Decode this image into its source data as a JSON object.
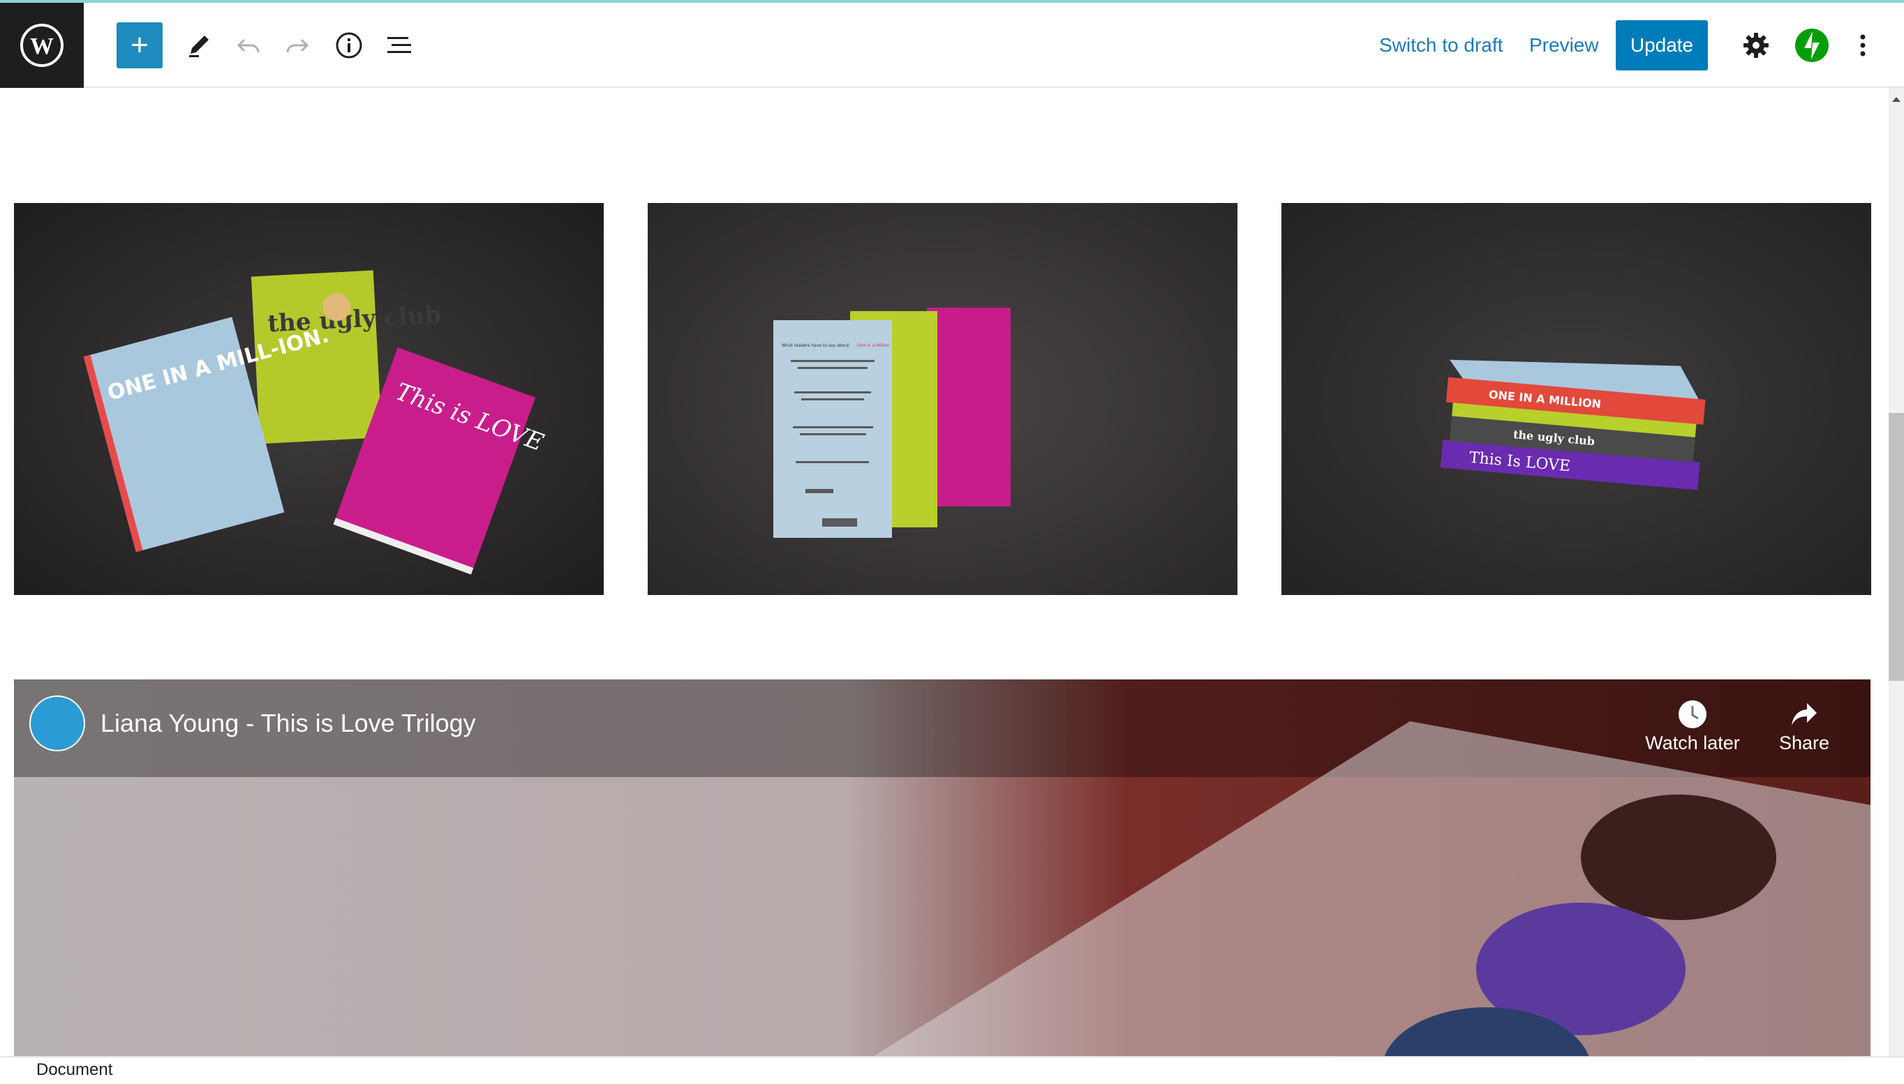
{
  "header": {
    "add_block_label": "+",
    "switch_to_draft": "Switch to draft",
    "preview": "Preview",
    "update": "Update"
  },
  "gallery": {
    "images": [
      {
        "covers": [
          "ONE IN A MILL-ION.",
          "the ugly club",
          "This is LOVE"
        ]
      },
      {
        "back_heading": "What readers have to say about",
        "back_heading_accent": "One in a Million"
      },
      {
        "stack": [
          "ONE IN A MILLION",
          "the ugly club",
          "This Is LOVE"
        ]
      }
    ]
  },
  "video": {
    "title": "Liana Young - This is Love Trilogy",
    "watch_later": "Watch later",
    "share": "Share"
  },
  "footer": {
    "breadcrumb": "Document"
  },
  "colors": {
    "accent": "#007cba",
    "link": "#1c7ab8",
    "jetpack": "#069e08"
  }
}
